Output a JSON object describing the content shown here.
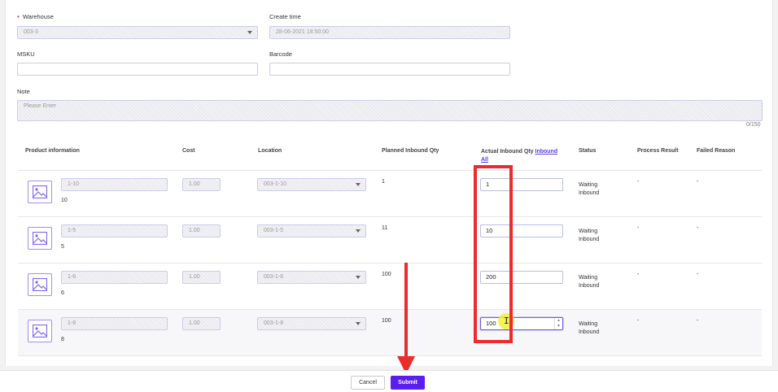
{
  "form": {
    "warehouse_label": "Warehouse",
    "warehouse_required_mark": "•",
    "warehouse_value": "003-3",
    "create_time_label": "Create time",
    "create_time_value": "28-06-2021 18:50:00",
    "msku_label": "MSKU",
    "msku_value": "",
    "barcode_label": "Barcode",
    "barcode_value": "",
    "note_label": "Note",
    "note_placeholder": "Please Enter",
    "note_counter": "0/150"
  },
  "table": {
    "headers": {
      "product": "Product information",
      "cost": "Cost",
      "location": "Location",
      "planned": "Planned Inbound Qty",
      "actual": "Actual Inbound Qty",
      "inbound_all": "Inbound All",
      "status": "Status",
      "process_result": "Process Result",
      "failed_reason": "Failed Reason"
    },
    "rows": [
      {
        "sku": "1-10",
        "qty_label": "10",
        "cost": "1.00",
        "location": "003-1-10",
        "planned": "1",
        "actual": "1",
        "status_line1": "Waiting",
        "status_line2": "Inbound",
        "process_result": "-",
        "failed_reason": "-"
      },
      {
        "sku": "1-5",
        "qty_label": "5",
        "cost": "1.00",
        "location": "003-1-5",
        "planned": "11",
        "actual": "10",
        "status_line1": "Waiting",
        "status_line2": "Inbound",
        "process_result": "-",
        "failed_reason": "-"
      },
      {
        "sku": "1-6",
        "qty_label": "6",
        "cost": "1.00",
        "location": "003-1-6",
        "planned": "100",
        "actual": "200",
        "status_line1": "Waiting",
        "status_line2": "Inbound",
        "process_result": "-",
        "failed_reason": "-"
      },
      {
        "sku": "1-8",
        "qty_label": "8",
        "cost": "1.00",
        "location": "003-1-8",
        "planned": "100",
        "actual": "100",
        "status_line1": "Waiting",
        "status_line2": "Inbound",
        "process_result": "-",
        "failed_reason": "-"
      }
    ]
  },
  "icons": {
    "product_image": "image-placeholder-icon",
    "dropdown": "chevron-down-icon",
    "spinner_up": "▲",
    "spinner_down": "▼",
    "text_cursor": "I"
  },
  "footer": {
    "cancel_label": "Cancel",
    "submit_label": "Submit"
  },
  "colors": {
    "accent": "#5a1ef0",
    "annotation": "#ec2b2b",
    "required": "#e0353b"
  }
}
